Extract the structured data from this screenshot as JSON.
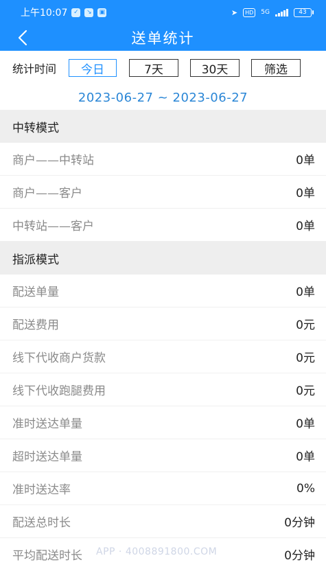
{
  "status_bar": {
    "time": "上午10:07",
    "network": "5G",
    "battery": "43"
  },
  "header": {
    "title": "送单统计",
    "back_icon": "chevron-left-icon"
  },
  "filter": {
    "label": "统计时间",
    "options": [
      "今日",
      "7天",
      "30天",
      "筛选"
    ],
    "selected": "今日"
  },
  "date_range": "2023-06-27 ~ 2023-06-27",
  "sections": [
    {
      "title": "中转模式",
      "rows": [
        {
          "label": "商户——中转站",
          "value": "0单"
        },
        {
          "label": "商户——客户",
          "value": "0单"
        },
        {
          "label": "中转站——客户",
          "value": "0单"
        }
      ]
    },
    {
      "title": "指派模式",
      "rows": [
        {
          "label": "配送单量",
          "value": "0单"
        },
        {
          "label": "配送费用",
          "value": "0元"
        },
        {
          "label": "线下代收商户货款",
          "value": "0元"
        },
        {
          "label": "线下代收跑腿费用",
          "value": "0元"
        },
        {
          "label": "准时送达单量",
          "value": "0单"
        },
        {
          "label": "超时送达单量",
          "value": "0单"
        },
        {
          "label": "准时送达率",
          "value": "0%"
        },
        {
          "label": "配送总时长",
          "value": "0分钟"
        },
        {
          "label": "平均配送时长",
          "value": "0分钟"
        }
      ]
    }
  ],
  "watermark": "APP · 4008891800.COM",
  "colors": {
    "primary": "#1e90ff",
    "date_text": "#2a86d6",
    "section_bg": "#eeeeee"
  }
}
